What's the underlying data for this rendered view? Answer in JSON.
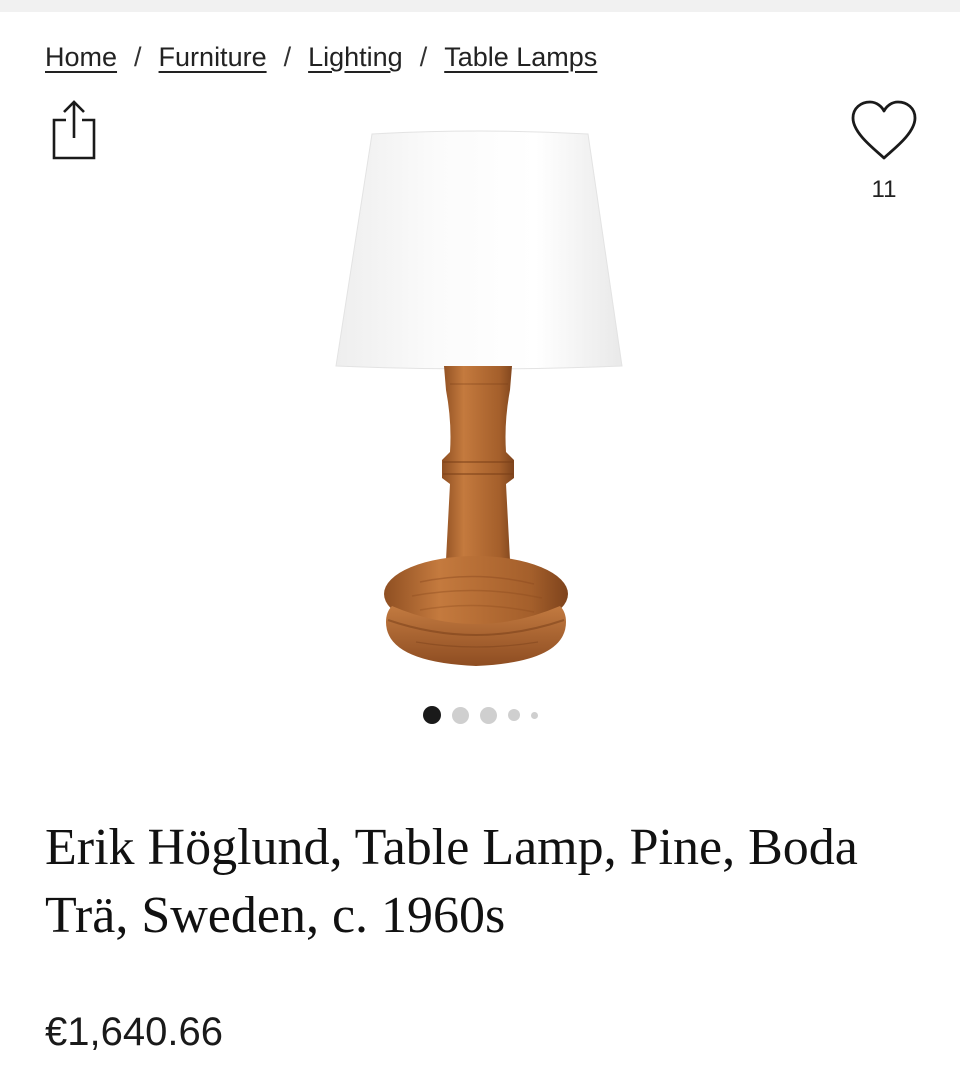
{
  "breadcrumb": {
    "items": [
      {
        "label": "Home"
      },
      {
        "label": "Furniture"
      },
      {
        "label": "Lighting"
      },
      {
        "label": "Table Lamps"
      }
    ],
    "separator": "/"
  },
  "actions": {
    "share_icon": "share-icon",
    "favorite_icon": "heart-outline-icon",
    "favorite_count": "11"
  },
  "gallery": {
    "image_subject": "table-lamp",
    "slide_count": 5,
    "active_slide": 1
  },
  "product": {
    "title": "Erik Höglund, Table Lamp, Pine, Boda Trä, Sweden, c. 1960s",
    "price": "€1,640.66"
  },
  "colors": {
    "text": "#1a1a1a",
    "dot_active": "#1a1a1a",
    "dot_inactive": "#cfcfcf",
    "shade": "#fafafa",
    "wood": "#b06a35"
  }
}
